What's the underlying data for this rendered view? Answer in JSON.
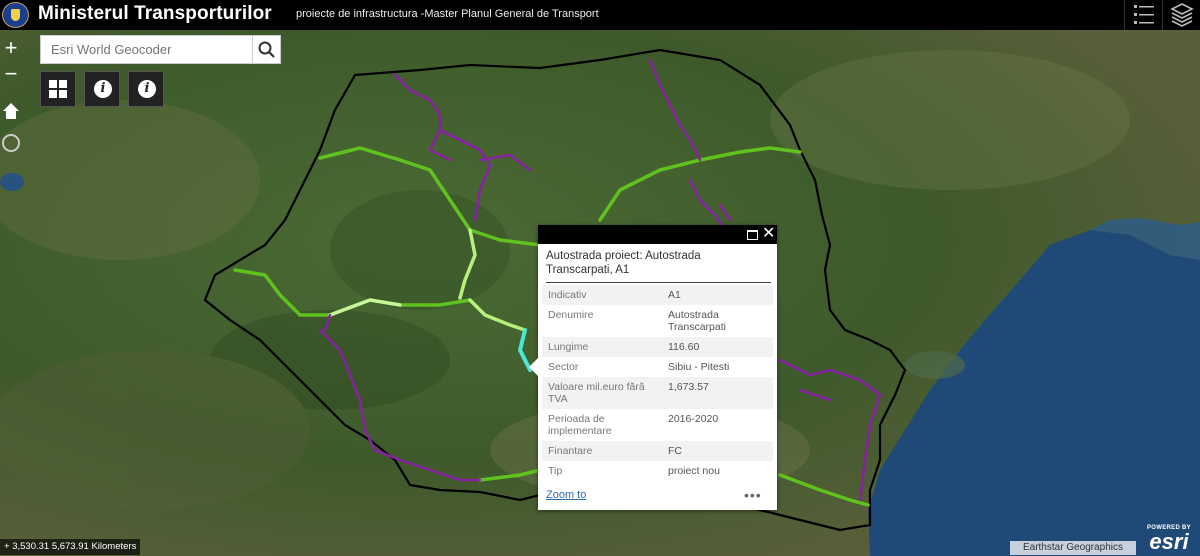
{
  "header": {
    "title": "Ministerul Transporturilor",
    "subtitle": "proiecte de infrastructura -Master Planul General de Transport",
    "logo_icon": "coat-of-arms",
    "list_icon": "list-icon",
    "layers_icon": "layers-icon"
  },
  "search": {
    "placeholder": "Esri World Geocoder",
    "value": ""
  },
  "controls": {
    "zoom_in": "+",
    "zoom_out": "−",
    "home_icon": "home-icon",
    "locate_icon": "locate-icon",
    "tools": [
      "grid-icon",
      "info-icon",
      "info-icon"
    ]
  },
  "popup": {
    "title": "Autostrada proiect: Autostrada Transcarpati, A1",
    "fields": [
      {
        "key": "Indicativ",
        "value": "A1"
      },
      {
        "key": "Denumire",
        "value": "Autostrada Transcarpati"
      },
      {
        "key": "Lungime",
        "value": "116.60"
      },
      {
        "key": "Sector",
        "value": "Sibiu - Pitesti"
      },
      {
        "key": "Valoare mil.euro fără TVA",
        "value": "1,673.57"
      },
      {
        "key": "Perioada de implementare",
        "value": "2016-2020"
      },
      {
        "key": "Finantare",
        "value": "FC"
      },
      {
        "key": "Tip",
        "value": "proiect nou"
      }
    ],
    "zoom_link": "Zoom to",
    "more": "•••"
  },
  "footer": {
    "scale_text": "3,530.31 5,673.91 Kilometers",
    "attribution": "Earthstar Geographics",
    "powered_by": "POWERED BY",
    "brand": "esri"
  },
  "colors": {
    "header_bg": "#000000",
    "sea": "#1f4a78",
    "land": "#3f5a2c",
    "border": "#000000",
    "motorway_existing": "#5fc21e",
    "motorway_project": "#b7f07a",
    "expressway": "#8a1fa8",
    "selected": "#49e6d6"
  }
}
